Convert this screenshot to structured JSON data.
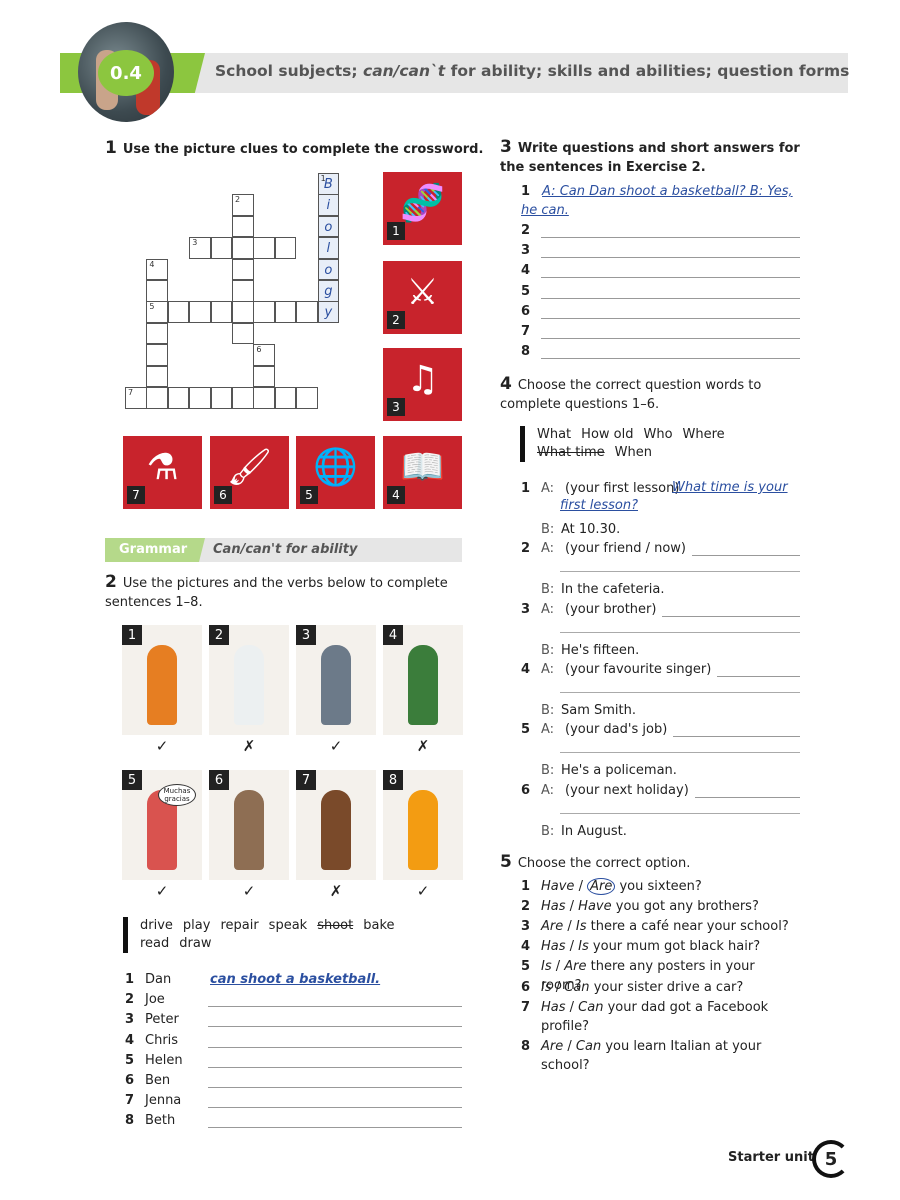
{
  "header": {
    "unit_number": "0.4",
    "title_pre": "School subjects; ",
    "title_it": "can/can`t",
    "title_post": " for ability; skills and abilities; question forms"
  },
  "ex1": {
    "number": "1",
    "instruction": "Use the picture clues to complete the crossword.",
    "clue_numbers": [
      "1",
      "2",
      "3",
      "4",
      "5",
      "6",
      "7"
    ],
    "answer_1_down": [
      "B",
      "i",
      "o",
      "l",
      "o",
      "g",
      "y"
    ],
    "picture_clues": [
      {
        "n": "1",
        "icon": "dna-icon"
      },
      {
        "n": "2",
        "icon": "helmet-sword-icon"
      },
      {
        "n": "3",
        "icon": "music-note-icon"
      },
      {
        "n": "7",
        "icon": "lab-flask-icon"
      },
      {
        "n": "6",
        "icon": "paintbrush-icon"
      },
      {
        "n": "5",
        "icon": "globe-icon"
      },
      {
        "n": "4",
        "icon": "book-icon"
      }
    ]
  },
  "grammar": {
    "tag": "Grammar",
    "title": "Can/can't for ability"
  },
  "ex2": {
    "number": "2",
    "instruction": "Use the pictures and the verbs below to complete sentences 1–8.",
    "pictures": [
      {
        "n": "1",
        "mark": "✓"
      },
      {
        "n": "2",
        "mark": "✗"
      },
      {
        "n": "3",
        "mark": "✓"
      },
      {
        "n": "4",
        "mark": "✗"
      },
      {
        "n": "5",
        "mark": "✓",
        "bubble": "Muchas gracias"
      },
      {
        "n": "6",
        "mark": "✓"
      },
      {
        "n": "7",
        "mark": "✗"
      },
      {
        "n": "8",
        "mark": "✓"
      }
    ],
    "verbs": [
      "drive",
      "play",
      "repair",
      "speak",
      "shoot",
      "bake",
      "read",
      "draw"
    ],
    "sentences": [
      {
        "n": "1",
        "name": "Dan",
        "answer": "can shoot a basketball."
      },
      {
        "n": "2",
        "name": "Joe"
      },
      {
        "n": "3",
        "name": "Peter"
      },
      {
        "n": "4",
        "name": "Chris"
      },
      {
        "n": "5",
        "name": "Helen"
      },
      {
        "n": "6",
        "name": "Ben"
      },
      {
        "n": "7",
        "name": "Jenna"
      },
      {
        "n": "8",
        "name": "Beth"
      }
    ]
  },
  "ex3": {
    "number": "3",
    "instruction": "Write questions and short answers for the sentences in Exercise 2.",
    "example_n": "1",
    "example": "A: Can Dan shoot a basketball? B: Yes, he can.",
    "items": [
      "2",
      "3",
      "4",
      "5",
      "6",
      "7",
      "8"
    ]
  },
  "ex4": {
    "number": "4",
    "instruction": "Choose the correct question words to complete questions 1–6.",
    "words": [
      "What",
      "How old",
      "Who",
      "Where",
      "What time",
      "When"
    ],
    "items": [
      {
        "n": "1",
        "a": "(your first lesson)",
        "answer": "What time is your first lesson?",
        "b": "At 10.30."
      },
      {
        "n": "2",
        "a": "(your friend / now)",
        "b": "In the cafeteria."
      },
      {
        "n": "3",
        "a": "(your brother)",
        "b": "He's fifteen."
      },
      {
        "n": "4",
        "a": "(your favourite singer)",
        "b": "Sam Smith."
      },
      {
        "n": "5",
        "a": "(your dad's job)",
        "b": "He's a policeman."
      },
      {
        "n": "6",
        "a": "(your next holiday)",
        "b": "In August."
      }
    ],
    "a_label": "A:",
    "b_label": "B:"
  },
  "ex5": {
    "number": "5",
    "instruction": "Choose the correct option.",
    "items": [
      {
        "n": "1",
        "o1": "Have",
        "o2": "Are",
        "rest": "you sixteen?",
        "circled": "Are"
      },
      {
        "n": "2",
        "o1": "Has",
        "o2": "Have",
        "rest": "you got any brothers?"
      },
      {
        "n": "3",
        "o1": "Are",
        "o2": "Is",
        "rest": "there a café near your school?"
      },
      {
        "n": "4",
        "o1": "Has",
        "o2": "Is",
        "rest": "your mum got black hair?"
      },
      {
        "n": "5",
        "o1": "Is",
        "o2": "Are",
        "rest": "there any posters in your room?"
      },
      {
        "n": "6",
        "o1": "Is",
        "o2": "Can",
        "rest": "your sister drive a car?"
      },
      {
        "n": "7",
        "o1": "Has",
        "o2": "Can",
        "rest": "your dad got a Facebook profile?"
      },
      {
        "n": "8",
        "o1": "Are",
        "o2": "Can",
        "rest": "you learn Italian at your school?"
      }
    ]
  },
  "footer": {
    "label": "Starter unit",
    "page": "5"
  },
  "colors": {
    "green": "#8cc63f",
    "red": "#c8232c",
    "answer_blue": "#2b4fa0"
  }
}
